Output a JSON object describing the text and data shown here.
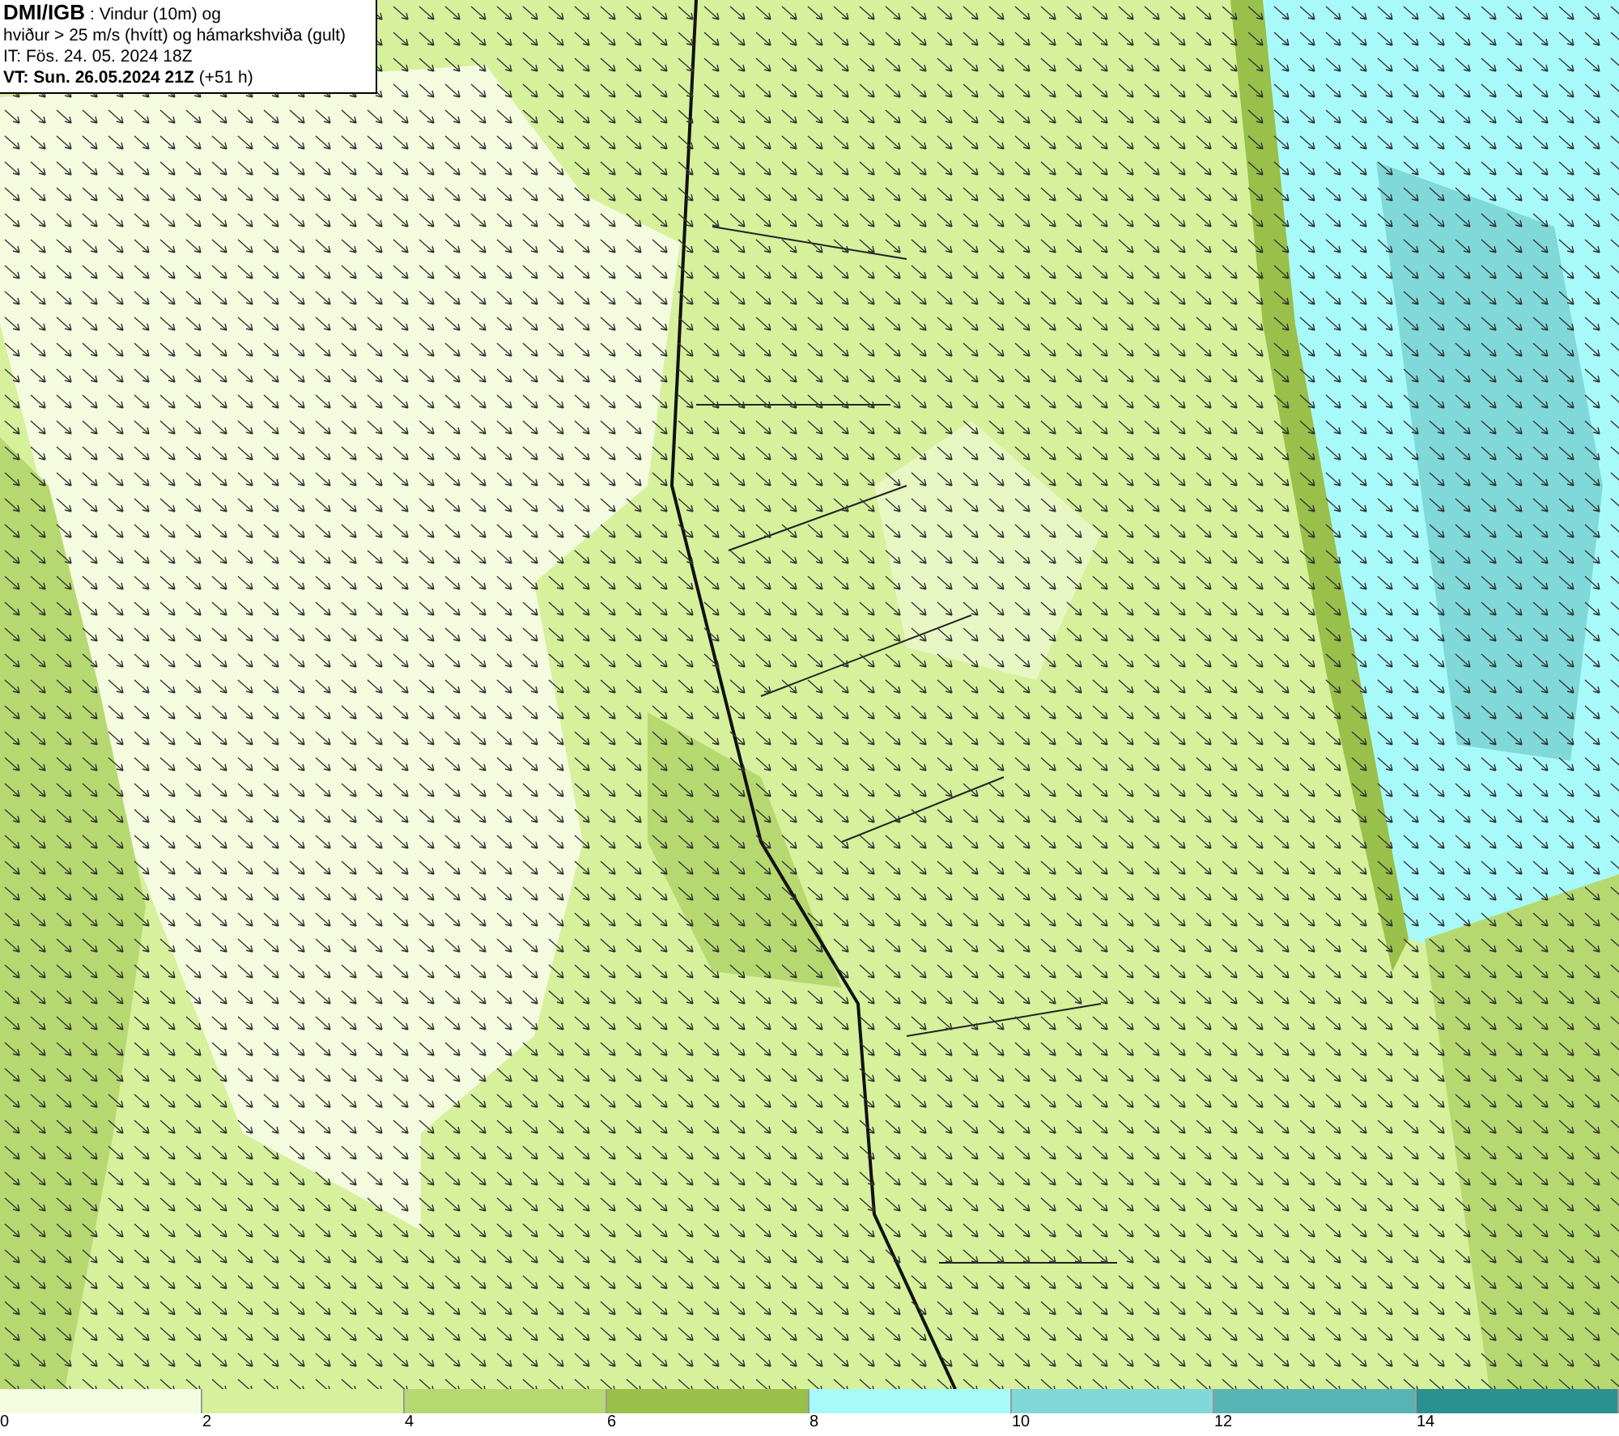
{
  "header": {
    "lines": [
      "**DMI/IGB** : Vindur (10m) og",
      "hviður > 25 m/s (hvítt) og hámarkshviða (gult)",
      "IT: Fös. 24. 05. 2024 18Z",
      "**VT: Sun. 26.05.2024 21Z** (+51 h)"
    ]
  },
  "legend": {
    "swatches": [
      {
        "color": "#f4fbdf"
      },
      {
        "color": "#d6f09c"
      },
      {
        "color": "#b6d870"
      },
      {
        "color": "#98c04a"
      },
      {
        "color": "#a8fafa"
      },
      {
        "color": "#80d8d8"
      },
      {
        "color": "#58b4b4"
      },
      {
        "color": "#2a9090"
      }
    ],
    "ticks": [
      "0",
      "2",
      "4",
      "6",
      "8",
      "10",
      "12",
      "14"
    ]
  }
}
